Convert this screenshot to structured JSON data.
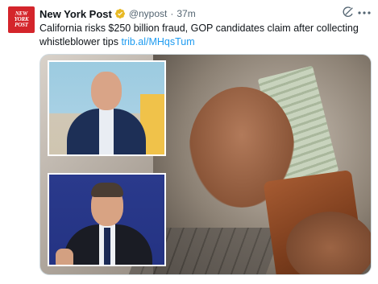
{
  "account": {
    "avatar_text": "NEW YORK POST",
    "display_name": "New York Post",
    "verified_icon": "verified-gold-check-icon",
    "handle": "@nypost",
    "separator": "·",
    "time": "37m"
  },
  "icons": {
    "grok": "grok-icon",
    "more": "more-icon"
  },
  "tweet": {
    "text": "California risks $250 billion fraud, GOP candidates claim after collecting whistleblower tips ",
    "link": "trib.al/MHqsTum"
  },
  "media": {
    "main_image": "hand-pulling-cash-from-wallet-photo",
    "inset_1": "bald-man-in-suit-photo",
    "inset_2": "man-in-suit-speaking-photo"
  },
  "colors": {
    "avatar_red": "#d4252b",
    "verified_gold": "#e8b923",
    "link_blue": "#1d9bf0",
    "secondary_text": "#536471"
  }
}
